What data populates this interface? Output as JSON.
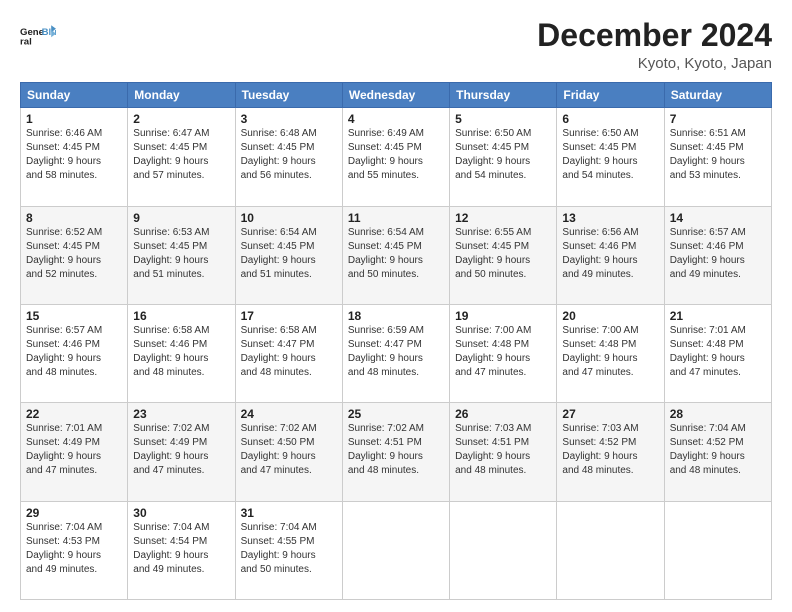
{
  "header": {
    "logo_line1": "General",
    "logo_line2": "Blue",
    "title": "December 2024",
    "subtitle": "Kyoto, Kyoto, Japan"
  },
  "columns": [
    "Sunday",
    "Monday",
    "Tuesday",
    "Wednesday",
    "Thursday",
    "Friday",
    "Saturday"
  ],
  "weeks": [
    [
      {
        "day": "1",
        "detail": "Sunrise: 6:46 AM\nSunset: 4:45 PM\nDaylight: 9 hours\nand 58 minutes."
      },
      {
        "day": "2",
        "detail": "Sunrise: 6:47 AM\nSunset: 4:45 PM\nDaylight: 9 hours\nand 57 minutes."
      },
      {
        "day": "3",
        "detail": "Sunrise: 6:48 AM\nSunset: 4:45 PM\nDaylight: 9 hours\nand 56 minutes."
      },
      {
        "day": "4",
        "detail": "Sunrise: 6:49 AM\nSunset: 4:45 PM\nDaylight: 9 hours\nand 55 minutes."
      },
      {
        "day": "5",
        "detail": "Sunrise: 6:50 AM\nSunset: 4:45 PM\nDaylight: 9 hours\nand 54 minutes."
      },
      {
        "day": "6",
        "detail": "Sunrise: 6:50 AM\nSunset: 4:45 PM\nDaylight: 9 hours\nand 54 minutes."
      },
      {
        "day": "7",
        "detail": "Sunrise: 6:51 AM\nSunset: 4:45 PM\nDaylight: 9 hours\nand 53 minutes."
      }
    ],
    [
      {
        "day": "8",
        "detail": "Sunrise: 6:52 AM\nSunset: 4:45 PM\nDaylight: 9 hours\nand 52 minutes."
      },
      {
        "day": "9",
        "detail": "Sunrise: 6:53 AM\nSunset: 4:45 PM\nDaylight: 9 hours\nand 51 minutes."
      },
      {
        "day": "10",
        "detail": "Sunrise: 6:54 AM\nSunset: 4:45 PM\nDaylight: 9 hours\nand 51 minutes."
      },
      {
        "day": "11",
        "detail": "Sunrise: 6:54 AM\nSunset: 4:45 PM\nDaylight: 9 hours\nand 50 minutes."
      },
      {
        "day": "12",
        "detail": "Sunrise: 6:55 AM\nSunset: 4:45 PM\nDaylight: 9 hours\nand 50 minutes."
      },
      {
        "day": "13",
        "detail": "Sunrise: 6:56 AM\nSunset: 4:46 PM\nDaylight: 9 hours\nand 49 minutes."
      },
      {
        "day": "14",
        "detail": "Sunrise: 6:57 AM\nSunset: 4:46 PM\nDaylight: 9 hours\nand 49 minutes."
      }
    ],
    [
      {
        "day": "15",
        "detail": "Sunrise: 6:57 AM\nSunset: 4:46 PM\nDaylight: 9 hours\nand 48 minutes."
      },
      {
        "day": "16",
        "detail": "Sunrise: 6:58 AM\nSunset: 4:46 PM\nDaylight: 9 hours\nand 48 minutes."
      },
      {
        "day": "17",
        "detail": "Sunrise: 6:58 AM\nSunset: 4:47 PM\nDaylight: 9 hours\nand 48 minutes."
      },
      {
        "day": "18",
        "detail": "Sunrise: 6:59 AM\nSunset: 4:47 PM\nDaylight: 9 hours\nand 48 minutes."
      },
      {
        "day": "19",
        "detail": "Sunrise: 7:00 AM\nSunset: 4:48 PM\nDaylight: 9 hours\nand 47 minutes."
      },
      {
        "day": "20",
        "detail": "Sunrise: 7:00 AM\nSunset: 4:48 PM\nDaylight: 9 hours\nand 47 minutes."
      },
      {
        "day": "21",
        "detail": "Sunrise: 7:01 AM\nSunset: 4:48 PM\nDaylight: 9 hours\nand 47 minutes."
      }
    ],
    [
      {
        "day": "22",
        "detail": "Sunrise: 7:01 AM\nSunset: 4:49 PM\nDaylight: 9 hours\nand 47 minutes."
      },
      {
        "day": "23",
        "detail": "Sunrise: 7:02 AM\nSunset: 4:49 PM\nDaylight: 9 hours\nand 47 minutes."
      },
      {
        "day": "24",
        "detail": "Sunrise: 7:02 AM\nSunset: 4:50 PM\nDaylight: 9 hours\nand 47 minutes."
      },
      {
        "day": "25",
        "detail": "Sunrise: 7:02 AM\nSunset: 4:51 PM\nDaylight: 9 hours\nand 48 minutes."
      },
      {
        "day": "26",
        "detail": "Sunrise: 7:03 AM\nSunset: 4:51 PM\nDaylight: 9 hours\nand 48 minutes."
      },
      {
        "day": "27",
        "detail": "Sunrise: 7:03 AM\nSunset: 4:52 PM\nDaylight: 9 hours\nand 48 minutes."
      },
      {
        "day": "28",
        "detail": "Sunrise: 7:04 AM\nSunset: 4:52 PM\nDaylight: 9 hours\nand 48 minutes."
      }
    ],
    [
      {
        "day": "29",
        "detail": "Sunrise: 7:04 AM\nSunset: 4:53 PM\nDaylight: 9 hours\nand 49 minutes."
      },
      {
        "day": "30",
        "detail": "Sunrise: 7:04 AM\nSunset: 4:54 PM\nDaylight: 9 hours\nand 49 minutes."
      },
      {
        "day": "31",
        "detail": "Sunrise: 7:04 AM\nSunset: 4:55 PM\nDaylight: 9 hours\nand 50 minutes."
      },
      {
        "day": "",
        "detail": ""
      },
      {
        "day": "",
        "detail": ""
      },
      {
        "day": "",
        "detail": ""
      },
      {
        "day": "",
        "detail": ""
      }
    ]
  ]
}
